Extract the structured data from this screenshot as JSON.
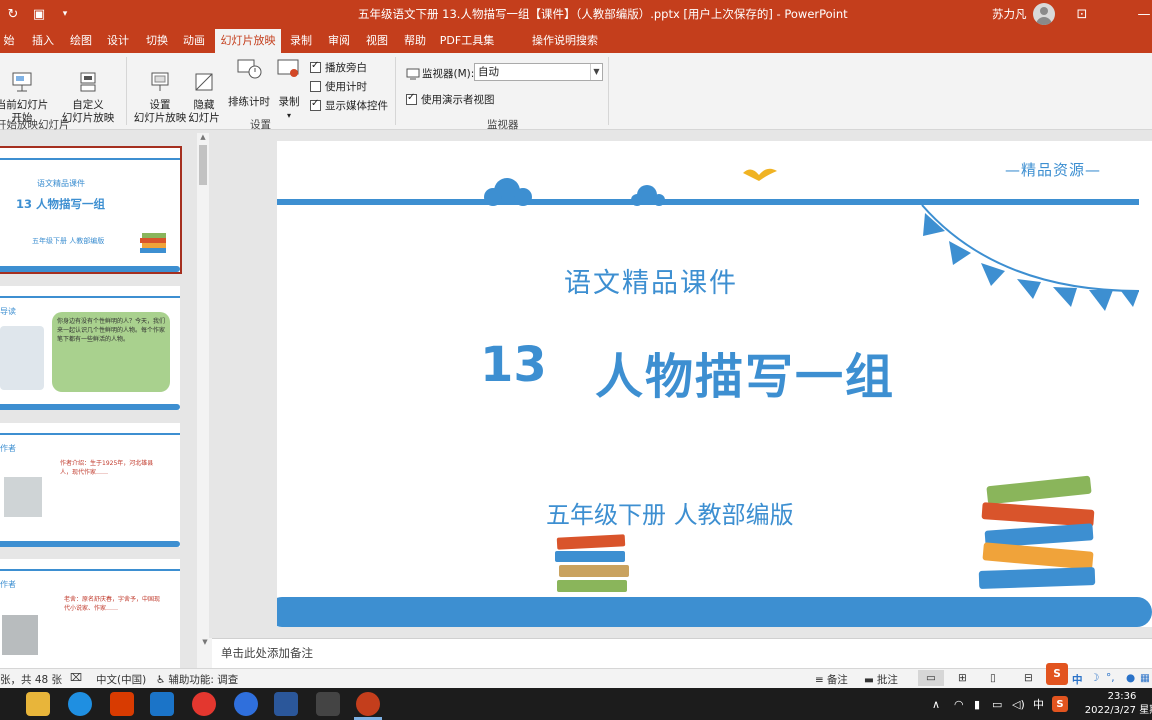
{
  "window": {
    "title": "五年级语文下册 13.人物描写一组【课件】（人教部编版）.pptx [用户上次保存的]  -  PowerPoint",
    "user": "苏力凡"
  },
  "tabs": [
    "始",
    "插入",
    "绘图",
    "设计",
    "切换",
    "动画",
    "幻灯片放映",
    "录制",
    "审阅",
    "视图",
    "帮助",
    "PDF工具集",
    "操作说明搜索"
  ],
  "ribbon": {
    "from_current": "当前幻灯片\n开始",
    "custom_show": "自定义\n幻灯片放映",
    "group_start": "开始放映幻灯片",
    "setup_show": "设置\n幻灯片放映",
    "hide_slide": "隐藏\n幻灯片",
    "rehearse": "排练计时",
    "record": "录制",
    "chk_narration": "播放旁白",
    "chk_timings": "使用计时",
    "chk_media": "显示媒体控件",
    "group_setup": "设置",
    "monitor_label": "监视器(M):",
    "monitor_value": "自动",
    "chk_presenter": "使用演示者视图",
    "group_monitor": "监视器"
  },
  "slide": {
    "brand": "—精品资源—",
    "subtitle": "语文精品课件",
    "number": "13",
    "title": "人物描写一组",
    "grade": "五年级下册  人教部编版"
  },
  "thumbnails": {
    "t1_sub": "语文精品课件",
    "t1_title": "13   人物描写一组",
    "t1_grade": "五年级下册  人教部编版",
    "t2_head": "导读",
    "t2_body": "你身边有没有个性鲜明的人？今天，我们来一起认识几个性鲜明的人物。每个作家笔下都有一些鲜活的人物。",
    "t3_head": "作者",
    "t3_body": "作者介绍：生于1925年，河北雄县人，现代作家……",
    "t4_head": "作者",
    "t4_body": "老舍：原名舒庆春，字舍予，中国现代小说家、作家……"
  },
  "notes": {
    "placeholder": "单击此处添加备注"
  },
  "status": {
    "slide_count": "张，共 48 张",
    "language": "中文(中国)",
    "accessibility": "辅助功能: 调查",
    "notes_btn": "备注",
    "comments_btn": "批注"
  },
  "taskbar": {
    "time": "23:36",
    "date": "2022/3/27 星期",
    "ime": "中"
  },
  "colors": {
    "ppt_red": "#c43e1c",
    "slide_blue": "#3d8fd1"
  }
}
